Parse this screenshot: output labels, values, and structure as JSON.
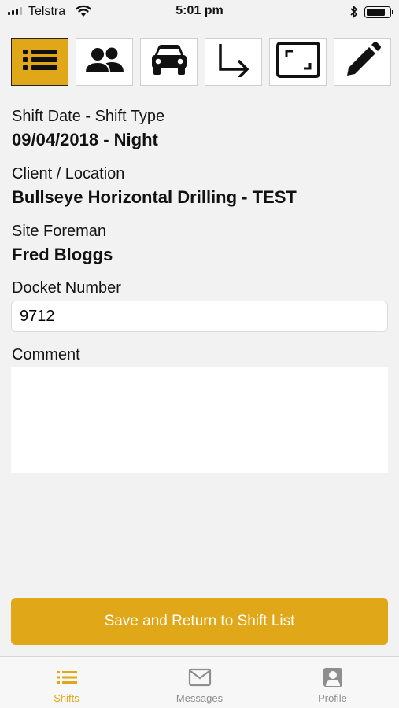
{
  "status_bar": {
    "carrier": "Telstra",
    "time": "5:01 pm",
    "battery_level": 0.85
  },
  "toolbar": {
    "buttons": [
      {
        "name": "details",
        "icon": "list-icon",
        "active": true
      },
      {
        "name": "crew",
        "icon": "people-icon",
        "active": false
      },
      {
        "name": "vehicle",
        "icon": "car-icon",
        "active": false
      },
      {
        "name": "next",
        "icon": "turn-right-arrow-icon",
        "active": false
      },
      {
        "name": "fullscreen",
        "icon": "frame-corners-icon",
        "active": false
      },
      {
        "name": "edit",
        "icon": "pencil-icon",
        "active": false
      }
    ],
    "accent_color": "#e0a818"
  },
  "form": {
    "shift_label": "Shift Date - Shift Type",
    "shift_value": "09/04/2018 - Night",
    "client_label": "Client / Location",
    "client_value": "Bullseye Horizontal Drilling - TEST",
    "foreman_label": "Site Foreman",
    "foreman_value": "Fred Bloggs",
    "docket_label": "Docket Number",
    "docket_value": "9712",
    "comment_label": "Comment",
    "comment_value": ""
  },
  "save_button": {
    "label": "Save and Return to Shift List"
  },
  "tab_bar": {
    "tabs": [
      {
        "label": "Shifts",
        "icon": "list-icon",
        "active": true
      },
      {
        "label": "Messages",
        "icon": "mail-icon",
        "active": false
      },
      {
        "label": "Profile",
        "icon": "person-icon",
        "active": false
      }
    ]
  }
}
